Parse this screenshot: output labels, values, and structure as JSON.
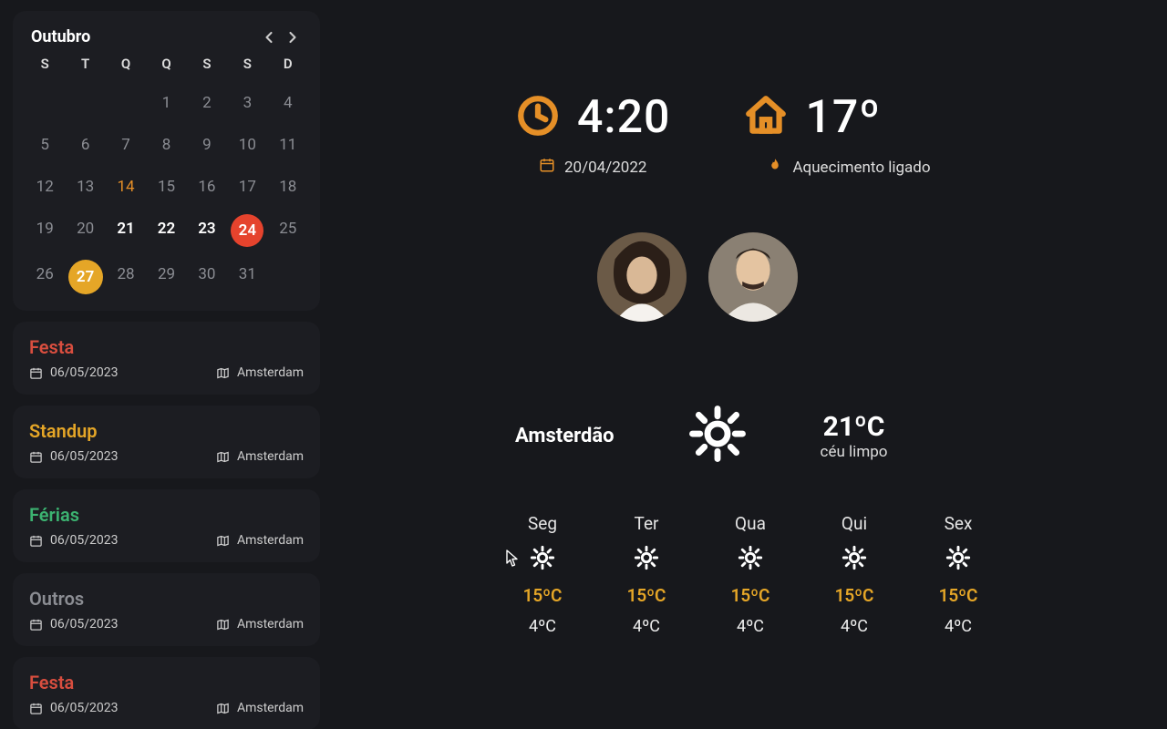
{
  "calendar": {
    "month_label": "Outubro",
    "dow": [
      "S",
      "T",
      "Q",
      "Q",
      "S",
      "S",
      "D"
    ],
    "weeks": [
      [
        null,
        null,
        null,
        1,
        2,
        3,
        4
      ],
      [
        5,
        6,
        7,
        8,
        9,
        10,
        11
      ],
      [
        12,
        13,
        14,
        15,
        16,
        17,
        18
      ],
      [
        19,
        20,
        21,
        22,
        23,
        24,
        25
      ],
      [
        26,
        27,
        28,
        29,
        30,
        31,
        null
      ]
    ],
    "orange_text_day": 14,
    "white_days": [
      21,
      22,
      23
    ],
    "red_circle_day": 24,
    "yellow_circle_day": 27
  },
  "events": [
    {
      "title": "Festa",
      "color": "c-red",
      "date": "06/05/2023",
      "location": "Amsterdam"
    },
    {
      "title": "Standup",
      "color": "c-orange",
      "date": "06/05/2023",
      "location": "Amsterdam"
    },
    {
      "title": "Férias",
      "color": "c-green",
      "date": "06/05/2023",
      "location": "Amsterdam"
    },
    {
      "title": "Outros",
      "color": "c-gray",
      "date": "06/05/2023",
      "location": "Amsterdam"
    },
    {
      "title": "Festa",
      "color": "c-red",
      "date": "06/05/2023",
      "location": "Amsterdam"
    }
  ],
  "clock": {
    "time": "4:20",
    "date": "20/04/2022"
  },
  "home": {
    "temp": "17º",
    "status": "Aquecimento ligado"
  },
  "weather": {
    "city": "Amsterdão",
    "temp": "21ºC",
    "desc": "céu limpo",
    "forecast": [
      {
        "d": "Seg",
        "hi": "15ºC",
        "lo": "4ºC"
      },
      {
        "d": "Ter",
        "hi": "15ºC",
        "lo": "4ºC"
      },
      {
        "d": "Qua",
        "hi": "15ºC",
        "lo": "4ºC"
      },
      {
        "d": "Qui",
        "hi": "15ºC",
        "lo": "4ºC"
      },
      {
        "d": "Sex",
        "hi": "15ºC",
        "lo": "4ºC"
      }
    ]
  }
}
